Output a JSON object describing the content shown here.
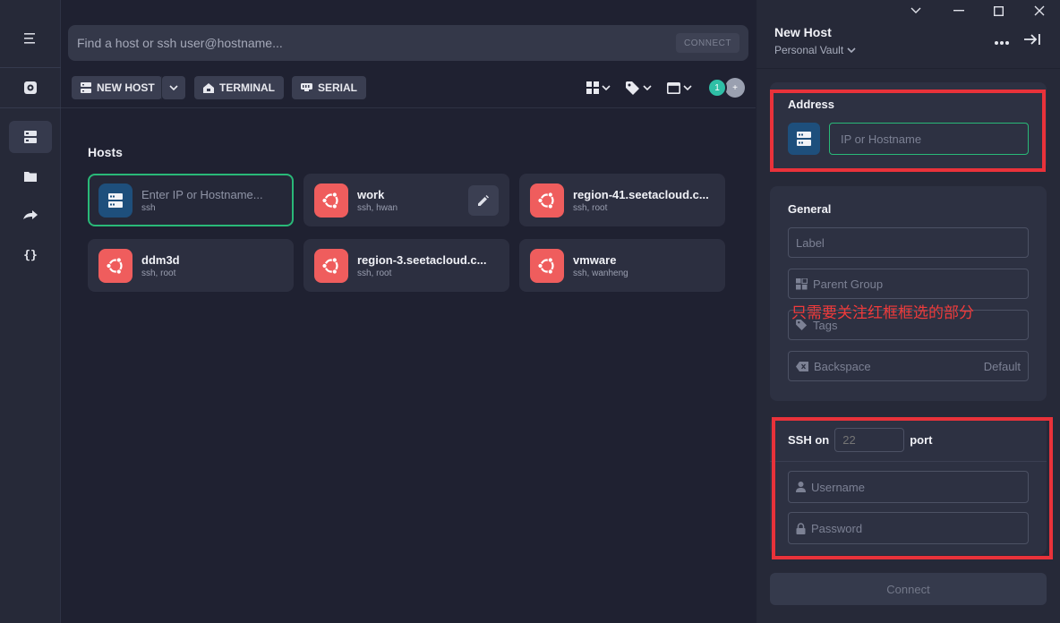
{
  "search": {
    "placeholder": "Find a host or ssh user@hostname...",
    "connect_label": "CONNECT"
  },
  "toolbar": {
    "new_host_label": "NEW HOST",
    "terminal_label": "TERMINAL",
    "serial_label": "SERIAL",
    "avatar_count": "1",
    "avatar_add": "+"
  },
  "hosts": {
    "title": "Hosts",
    "items": [
      {
        "name": "Enter IP or Hostname...",
        "sub": "ssh",
        "icon": "server-icon"
      },
      {
        "name": "work",
        "sub": "ssh, hwan",
        "icon": "ubuntu-icon"
      },
      {
        "name": "region-41.seetacloud.c...",
        "sub": "ssh, root",
        "icon": "ubuntu-icon"
      },
      {
        "name": "ddm3d",
        "sub": "ssh, root",
        "icon": "ubuntu-icon"
      },
      {
        "name": "region-3.seetacloud.c...",
        "sub": "ssh, root",
        "icon": "ubuntu-icon"
      },
      {
        "name": "vmware",
        "sub": "ssh, wanheng",
        "icon": "ubuntu-icon"
      }
    ]
  },
  "panel": {
    "title": "New Host",
    "vault": "Personal Vault",
    "address": {
      "title": "Address",
      "placeholder": "IP or Hostname"
    },
    "general": {
      "title": "General",
      "label_placeholder": "Label",
      "parent_group_placeholder": "Parent Group",
      "tags_placeholder": "Tags",
      "backspace_label": "Backspace",
      "backspace_value": "Default"
    },
    "ssh": {
      "prefix": "SSH on",
      "port_placeholder": "22",
      "suffix": "port",
      "username_placeholder": "Username",
      "password_placeholder": "Password"
    },
    "connect_label": "Connect"
  },
  "annotation": "只需要关注红框框选的部分",
  "colors": {
    "accent_green": "#29b978",
    "ubuntu_red": "#ef5d5d",
    "server_blue": "#1e4f7c",
    "highlight_red": "#e9323a"
  }
}
